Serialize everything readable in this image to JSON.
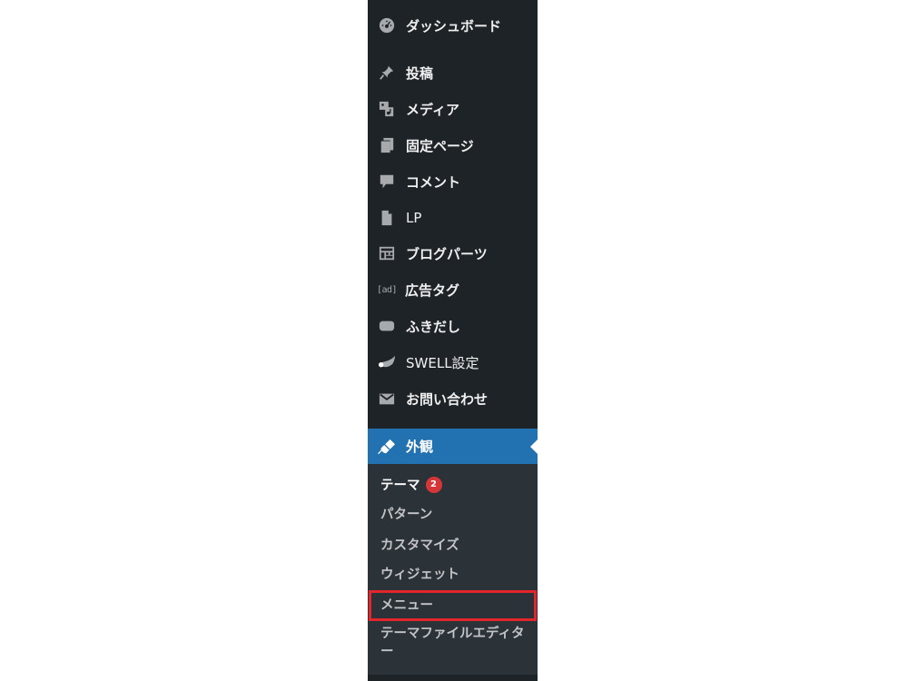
{
  "sidebar": {
    "items": [
      {
        "label": "ダッシュボード",
        "icon": "dashboard-icon"
      },
      {
        "label": "投稿",
        "icon": "pin-icon"
      },
      {
        "label": "メディア",
        "icon": "media-icon"
      },
      {
        "label": "固定ページ",
        "icon": "pages-icon"
      },
      {
        "label": "コメント",
        "icon": "comment-icon"
      },
      {
        "label": "LP",
        "icon": "page-icon"
      },
      {
        "label": "ブログパーツ",
        "icon": "layout-icon"
      },
      {
        "label": "広告タグ",
        "icon": "ad-icon",
        "icon_text": "[ad]"
      },
      {
        "label": "ふきだし",
        "icon": "speech-bubble-icon"
      },
      {
        "label": "SWELL設定",
        "icon": "swell-icon"
      },
      {
        "label": "お問い合わせ",
        "icon": "email-icon"
      },
      {
        "label": "外観",
        "icon": "brush-icon",
        "current": true
      }
    ],
    "submenu": [
      {
        "label": "テーマ",
        "badge": "2",
        "active": true
      },
      {
        "label": "パターン"
      },
      {
        "label": "カスタマイズ"
      },
      {
        "label": "ウィジェット"
      },
      {
        "label": "メニュー",
        "highlighted": true
      },
      {
        "label": "テーマファイルエディター"
      }
    ]
  },
  "colors": {
    "sidebar_bg": "#1d2327",
    "submenu_bg": "#2c3338",
    "current_bg": "#2271b1",
    "badge": "#d63638",
    "highlight": "#e3262b"
  }
}
